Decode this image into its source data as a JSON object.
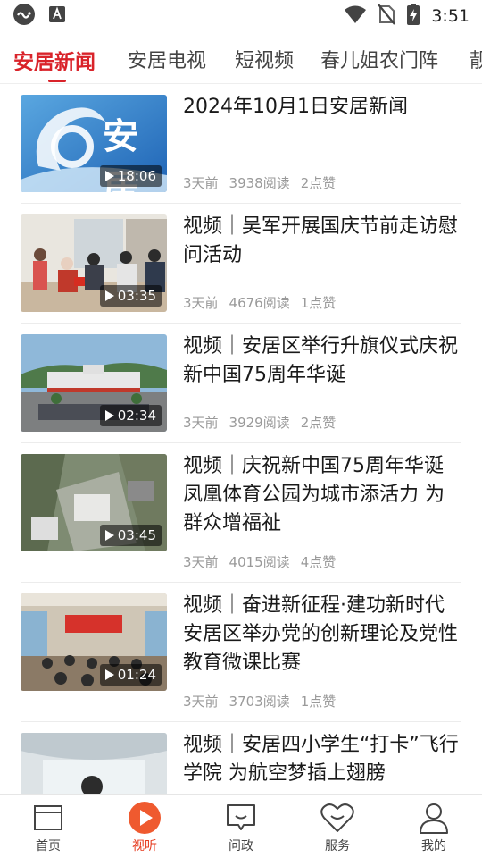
{
  "status_bar": {
    "time": "3:51",
    "icons": [
      "cast-app-icon",
      "text-a-app-icon",
      "wifi-icon",
      "no-sim-icon",
      "battery-charging-icon"
    ]
  },
  "colors": {
    "accent": "#d9232a",
    "nav_active": "#e63a1e",
    "text": "#1a1a1a",
    "meta": "#9a9a9a"
  },
  "tabs": [
    {
      "label": "安居新闻",
      "active": true
    },
    {
      "label": "安居电视",
      "active": false
    },
    {
      "label": "短视频",
      "active": false
    },
    {
      "label": "春儿姐农门阵",
      "active": false
    },
    {
      "label": "靓",
      "active": false
    }
  ],
  "news": [
    {
      "title": "2024年10月1日安居新闻",
      "duration": "18:06",
      "time_ago": "3天前",
      "reads": "3938阅读",
      "likes": "2点赞",
      "thumb_logo": "安居"
    },
    {
      "title": "视频｜吴军开展国庆节前走访慰问活动",
      "duration": "03:35",
      "time_ago": "3天前",
      "reads": "4676阅读",
      "likes": "1点赞"
    },
    {
      "title": "视频｜安居区举行升旗仪式庆祝新中国75周年华诞",
      "duration": "02:34",
      "time_ago": "3天前",
      "reads": "3929阅读",
      "likes": "2点赞"
    },
    {
      "title": "视频｜庆祝新中国75周年华诞 凤凰体育公园为城市添活力 为群众增福祉",
      "duration": "03:45",
      "time_ago": "3天前",
      "reads": "4015阅读",
      "likes": "4点赞"
    },
    {
      "title": "视频｜奋进新征程·建功新时代 安居区举办党的创新理论及党性教育微课比赛",
      "duration": "01:24",
      "time_ago": "3天前",
      "reads": "3703阅读",
      "likes": "1点赞"
    },
    {
      "title": "视频｜安居四小学生“打卡”飞行学院 为航空梦插上翅膀",
      "duration": "",
      "time_ago": "",
      "reads": "",
      "likes": ""
    }
  ],
  "bottom_nav": [
    {
      "label": "首页",
      "icon": "home-icon",
      "active": false
    },
    {
      "label": "视听",
      "icon": "play-icon",
      "active": true
    },
    {
      "label": "问政",
      "icon": "chat-icon",
      "active": false
    },
    {
      "label": "服务",
      "icon": "heart-icon",
      "active": false
    },
    {
      "label": "我的",
      "icon": "user-icon",
      "active": false
    }
  ]
}
